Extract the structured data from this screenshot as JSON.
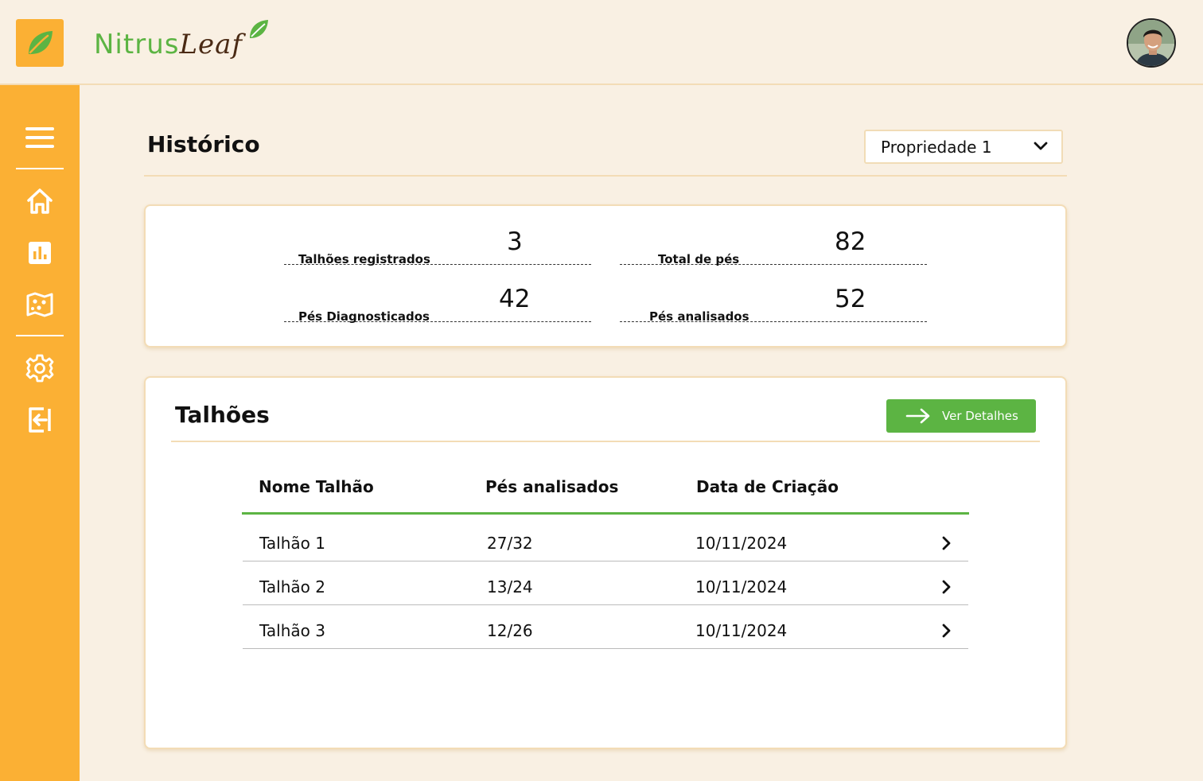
{
  "brand": {
    "name_part1": "Nitrus",
    "name_part2": "Leaf"
  },
  "colors": {
    "accent": "#fbb034",
    "brand_green": "#5cb443",
    "background": "#f9f0e3"
  },
  "sidebar": {
    "items": [
      {
        "icon": "menu-icon"
      },
      {
        "icon": "home-icon"
      },
      {
        "icon": "bar-chart-icon"
      },
      {
        "icon": "map-icon"
      },
      {
        "icon": "gear-icon"
      },
      {
        "icon": "logout-icon"
      }
    ]
  },
  "page": {
    "title": "Histórico",
    "property_select": "Propriedade 1"
  },
  "stats": {
    "registered_plots": {
      "label": "Talhões registrados",
      "value": "3"
    },
    "total_trees": {
      "label": "Total de pés",
      "value": "82"
    },
    "diagnosed_trees": {
      "label": "Pés Diagnosticados",
      "value": "42"
    },
    "analyzed_trees": {
      "label": "Pés analisados",
      "value": "52"
    }
  },
  "plots": {
    "title": "Talhões",
    "details_button": "Ver Detalhes",
    "columns": [
      "Nome Talhão",
      "Pés analisados",
      "Data de Criação"
    ],
    "rows": [
      {
        "name": "Talhão 1",
        "analyzed": "27/32",
        "created": "10/11/2024"
      },
      {
        "name": "Talhão 2",
        "analyzed": "13/24",
        "created": "10/11/2024"
      },
      {
        "name": "Talhão 3",
        "analyzed": "12/26",
        "created": "10/11/2024"
      }
    ]
  }
}
